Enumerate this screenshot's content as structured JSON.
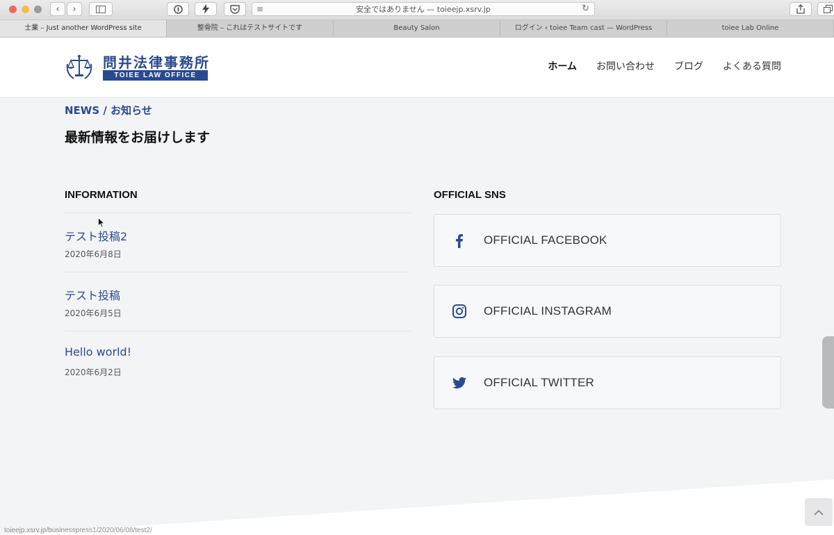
{
  "browser": {
    "address_text": "安全ではありません — toieejp.xsrv.jp",
    "tabs": [
      "士業 – Just another WordPress site",
      "整骨院 – これはテストサイトです",
      "Beauty Salon",
      "ログイン ‹ toiee Team cast — WordPress",
      "toiee Lab Online"
    ],
    "status_url": "toieejp.xsrv.jp/businesspress1/2020/06/08/test2/"
  },
  "header": {
    "logo_jp": "問井法律事務所",
    "logo_en": "TOIEE LAW OFFICE",
    "nav": [
      "ホーム",
      "お問い合わせ",
      "ブログ",
      "よくある質問"
    ]
  },
  "news": {
    "label": "NEWS / お知らせ",
    "headline": "最新情報をお届けします"
  },
  "information": {
    "title": "INFORMATION",
    "posts": [
      {
        "title": "テスト投稿2",
        "date": "2020年6月8日"
      },
      {
        "title": "テスト投稿",
        "date": "2020年6月5日"
      },
      {
        "title": "Hello world!",
        "date": "2020年6月2日"
      }
    ]
  },
  "sns": {
    "title": "OFFICIAL SNS",
    "links": [
      {
        "label": "OFFICIAL FACEBOOK",
        "icon": "facebook-icon"
      },
      {
        "label": "OFFICIAL INSTAGRAM",
        "icon": "instagram-icon"
      },
      {
        "label": "OFFICIAL TWITTER",
        "icon": "twitter-icon"
      }
    ]
  },
  "colors": {
    "brand_navy": "#2a4a8f",
    "page_bg": "#f3f4f6"
  }
}
